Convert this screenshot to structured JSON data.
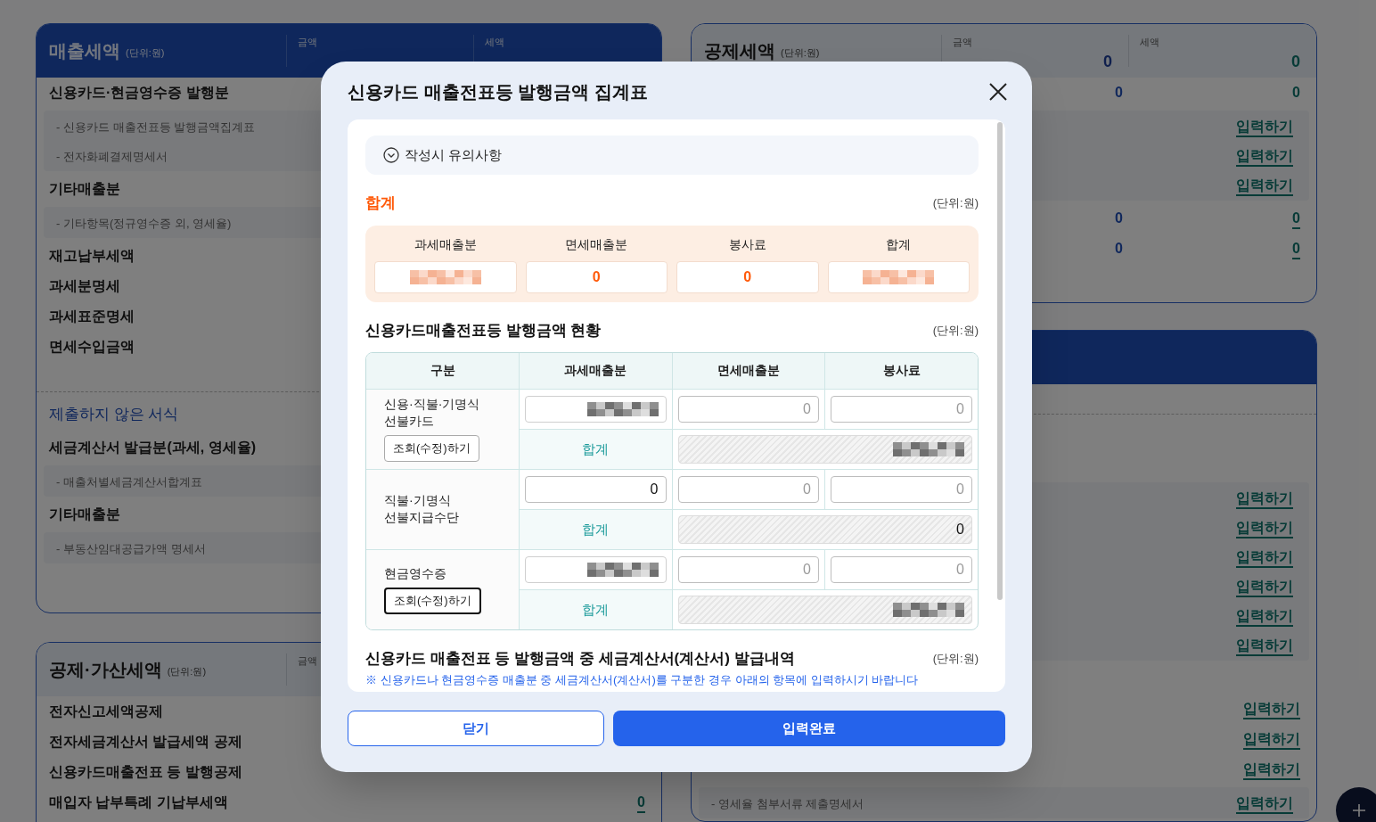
{
  "page": {
    "left_cards": [
      {
        "title": "매출세액",
        "unit": "(단위:원)",
        "kind": "dark",
        "columns": [
          {
            "label": "금액"
          },
          {
            "label": "세액"
          }
        ],
        "rows": [
          {
            "kind": "main",
            "label": "신용카드·현금영수증 발행분"
          },
          {
            "kind": "group",
            "rows": [
              {
                "kind": "sub",
                "label": "- 신용카드 매출전표등 발행금액집계표"
              },
              {
                "kind": "sub",
                "label": "- 전자화폐결제명세서"
              }
            ]
          },
          {
            "kind": "main",
            "label": "기타매출분"
          },
          {
            "kind": "group",
            "rows": [
              {
                "kind": "sub",
                "label": "- 기타항목(정규영수증 외, 영세율)"
              }
            ]
          },
          {
            "kind": "main",
            "label": "재고납부세액"
          },
          {
            "kind": "main",
            "label": "과세분명세"
          },
          {
            "kind": "main",
            "label": "과세표준명세"
          },
          {
            "kind": "main",
            "label": "면세수입금액"
          },
          {
            "kind": "divider"
          },
          {
            "kind": "section",
            "label": "제출하지 않은 서식"
          },
          {
            "kind": "main",
            "label": "세금계산서 발급분(과세, 영세율)"
          },
          {
            "kind": "group",
            "rows": [
              {
                "kind": "sub",
                "label": "- 매출처별세금계산서합계표"
              }
            ]
          },
          {
            "kind": "main",
            "label": "기타매출분"
          },
          {
            "kind": "group",
            "rows": [
              {
                "kind": "sub",
                "label": "- 부동산임대공급가액 명세서"
              }
            ]
          }
        ]
      },
      {
        "title": "공제·가산세액",
        "unit": "(단위:원)",
        "kind": "light",
        "columns": [
          {
            "label": "금액"
          }
        ],
        "rows": [
          {
            "kind": "main",
            "label": "전자신고세액공제"
          },
          {
            "kind": "main",
            "label": "전자세금계산서 발급세액 공제"
          },
          {
            "kind": "main",
            "label": "신용카드매출전표 등 발행공제"
          },
          {
            "kind": "main",
            "label": "매입자 납부특례 기납부세액",
            "amount": {
              "text": "0",
              "link": true
            }
          }
        ]
      }
    ],
    "right_cards": [
      {
        "title": "공제세액",
        "unit": "(단위:원)",
        "kind": "light",
        "columns": [
          {
            "label": "금액",
            "total": "0"
          },
          {
            "label": "세액",
            "total": "0"
          }
        ],
        "rows": [
          {
            "kind": "main",
            "amount": {
              "text": "0",
              "link": false
            },
            "tax": {
              "text": "0",
              "link": false
            }
          },
          {
            "kind": "group",
            "rows": [
              {
                "kind": "sub",
                "tax": {
                  "text": "입력하기",
                  "link": true
                }
              },
              {
                "kind": "sub",
                "tax": {
                  "text": "입력하기",
                  "link": true
                }
              },
              {
                "kind": "sub",
                "tax": {
                  "text": "입력하기",
                  "link": true
                }
              }
            ]
          },
          {
            "kind": "main",
            "amount": {
              "text": "0",
              "link": false
            },
            "tax": {
              "text": "0",
              "link": true
            }
          },
          {
            "kind": "main",
            "amount": {
              "text": "0",
              "link": false
            },
            "tax": {
              "text": "0",
              "link": true
            }
          }
        ]
      },
      {
        "kind": "dark",
        "rows": [
          {
            "kind": "divider"
          },
          {
            "kind": "blank"
          },
          {
            "kind": "blank"
          },
          {
            "kind": "group",
            "rows": [
              {
                "kind": "sub",
                "tax": {
                  "text": "입력하기",
                  "link": true
                }
              },
              {
                "kind": "sub",
                "tax": {
                  "text": "입력하기",
                  "link": true
                }
              },
              {
                "kind": "sub",
                "tax": {
                  "text": "입력하기",
                  "link": true
                }
              },
              {
                "kind": "sub",
                "tax": {
                  "text": "입력하기",
                  "link": true
                }
              },
              {
                "kind": "sub",
                "tax": {
                  "text": "입력하기",
                  "link": true
                }
              },
              {
                "kind": "sub",
                "tax": {
                  "text": "입력하기",
                  "link": true
                }
              }
            ]
          },
          {
            "kind": "blank"
          },
          {
            "kind": "main",
            "tax": {
              "text": "입력하기",
              "link": true
            }
          },
          {
            "kind": "main",
            "tax": {
              "text": "입력하기",
              "link": true
            }
          },
          {
            "kind": "main",
            "tax": {
              "text": "입력하기",
              "link": true
            }
          },
          {
            "kind": "group",
            "rows": [
              {
                "kind": "sub",
                "label": "- 영세율 첨부서류 제출명세서",
                "tax": {
                  "text": "입력하기",
                  "link": true
                }
              }
            ]
          }
        ]
      }
    ]
  },
  "dialog": {
    "title": "신용카드 매출전표등 발행금액 집계표",
    "notice": {
      "label": "작성시 유의사항",
      "expanded": false
    },
    "summary": {
      "title": "합계",
      "unit": "(단위:원)",
      "columns": [
        {
          "label": "과세매출분",
          "redacted": true
        },
        {
          "label": "면세매출분",
          "value": "0"
        },
        {
          "label": "봉사료",
          "value": "0"
        },
        {
          "label": "합계",
          "redacted": true
        }
      ]
    },
    "detail": {
      "title": "신용카드매출전표등 발행금액 현황",
      "unit": "(단위:원)",
      "columns": [
        "구분",
        "과세매출분",
        "면세매출분",
        "봉사료"
      ],
      "rows": [
        {
          "label": "신용·직불·기명식\n선불카드",
          "button": {
            "label": "조회(수정)하기",
            "focused": false
          },
          "taxable": {
            "redacted": true
          },
          "exempt": {
            "placeholder": "0"
          },
          "service": {
            "placeholder": "0"
          },
          "sum_label": "합계",
          "sum": {
            "redacted": true
          }
        },
        {
          "label": "직불·기명식\n선불지급수단",
          "taxable": {
            "value": "0"
          },
          "exempt": {
            "placeholder": "0"
          },
          "service": {
            "placeholder": "0"
          },
          "sum_label": "합계",
          "sum": {
            "value": "0"
          }
        },
        {
          "label": "현금영수증",
          "button": {
            "label": "조회(수정)하기",
            "focused": true
          },
          "taxable": {
            "redacted": true
          },
          "exempt": {
            "placeholder": "0"
          },
          "service": {
            "placeholder": "0"
          },
          "sum_label": "합계",
          "sum": {
            "redacted": true
          }
        }
      ]
    },
    "invoice": {
      "title": "신용카드 매출전표 등 발행금액 중 세금계산서(계산서) 발급내역",
      "unit": "(단위:원)",
      "note": "※ 신용카드나 현금영수증 매출분 중 세금계산서(계산서)를 구분한 경우 아래의 항목에 입력하시기 바랍니다"
    },
    "buttons": [
      {
        "kind": "secondary",
        "label": "닫기"
      },
      {
        "kind": "primary",
        "label": "입력완료"
      }
    ]
  }
}
